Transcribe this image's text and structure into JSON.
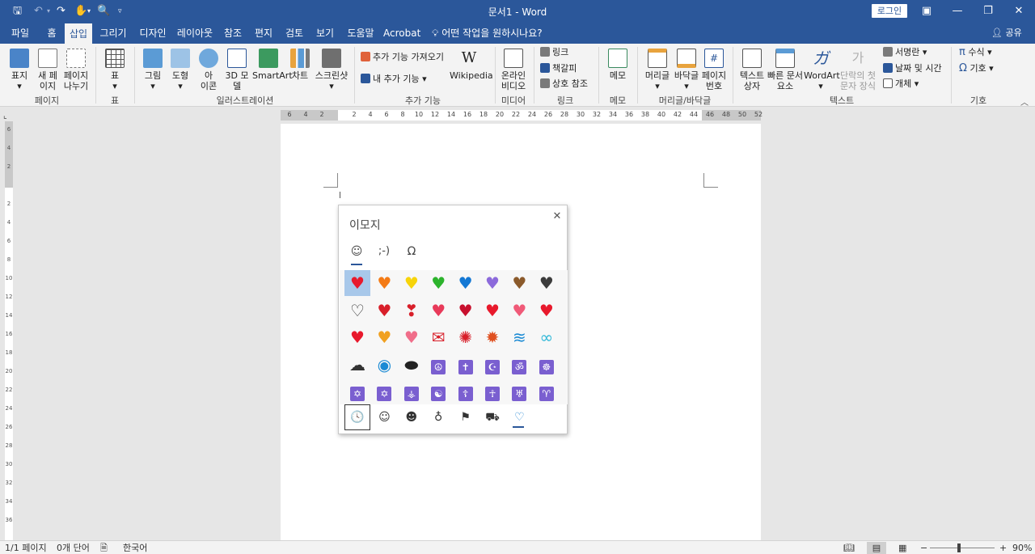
{
  "titlebar": {
    "title": "문서1  -  Word",
    "login": "로그인"
  },
  "tabs": [
    {
      "label": "파일",
      "active": false
    },
    {
      "label": "홈",
      "active": false
    },
    {
      "label": "삽입",
      "active": true
    },
    {
      "label": "그리기",
      "active": false
    },
    {
      "label": "디자인",
      "active": false
    },
    {
      "label": "레이아웃",
      "active": false
    },
    {
      "label": "참조",
      "active": false
    },
    {
      "label": "편지",
      "active": false
    },
    {
      "label": "검토",
      "active": false
    },
    {
      "label": "보기",
      "active": false
    },
    {
      "label": "도움말",
      "active": false
    },
    {
      "label": "Acrobat",
      "active": false
    }
  ],
  "tellme": "어떤 작업을 원하시나요?",
  "share": "공유",
  "ribbon": {
    "pages": {
      "cover": "표지",
      "blank": "새 페\n이지",
      "break": "페이지\n나누기",
      "group": "페이지"
    },
    "table": {
      "table": "표",
      "group": "표"
    },
    "illus": {
      "picture": "그림",
      "shape": "도형",
      "icon": "아\n이콘",
      "model3d": "3D 모\n델",
      "smartart": "SmartArt",
      "chart": "차트",
      "screenshot": "스크린샷",
      "group": "일러스트레이션"
    },
    "addins": {
      "get": "추가 기능 가져오기",
      "my": "내 추가 기능",
      "wikipedia": "Wikipedia",
      "group": "추가 기능"
    },
    "media": {
      "video": "온라인\n비디오",
      "group": "미디어"
    },
    "links": {
      "link": "링크",
      "bookmark": "책갈피",
      "xref": "상호 참조",
      "group": "링크"
    },
    "comments": {
      "comment": "메모",
      "group": "메모"
    },
    "hf": {
      "header": "머리글",
      "footer": "바닥글",
      "pagenum": "페이지\n번호",
      "group": "머리글/바닥글"
    },
    "text": {
      "textbox": "텍스트\n상자",
      "quickparts": "빠른 문서\n요소",
      "wordart": "WordArt",
      "dropcap": "단락의 첫\n문자 장식",
      "signature": "서명란",
      "datetime": "날짜 및 시간",
      "object": "개체",
      "group": "텍스트"
    },
    "symbols": {
      "equation": "수식",
      "symbol": "기호",
      "group": "기호"
    }
  },
  "ruler": {
    "h": [
      "6",
      "4",
      "2",
      "",
      "2",
      "4",
      "6",
      "8",
      "10",
      "12",
      "14",
      "16",
      "18",
      "20",
      "22",
      "24",
      "26",
      "28",
      "30",
      "32",
      "34",
      "36",
      "38",
      "40",
      "42",
      "44",
      "46",
      "48",
      "50",
      "52"
    ],
    "v": [
      "6",
      "4",
      "2",
      "",
      "2",
      "4",
      "6",
      "8",
      "10",
      "12",
      "14",
      "16",
      "18",
      "20",
      "22",
      "24",
      "26",
      "28",
      "30",
      "32",
      "34",
      "36"
    ]
  },
  "emoji_panel": {
    "title": "이모지",
    "tabs": [
      {
        "glyph": "☺"
      },
      {
        "glyph": ";-)"
      },
      {
        "glyph": "Ω"
      }
    ],
    "rows": [
      [
        {
          "g": "♥",
          "c": "#e8192c"
        },
        {
          "g": "♥",
          "c": "#f47b16"
        },
        {
          "g": "♥",
          "c": "#f7d40a"
        },
        {
          "g": "♥",
          "c": "#2cb32c"
        },
        {
          "g": "♥",
          "c": "#1478d4"
        },
        {
          "g": "♥",
          "c": "#8c6adb"
        },
        {
          "g": "♥",
          "c": "#8b5a2b"
        },
        {
          "g": "♥",
          "c": "#3c3c3c"
        }
      ],
      [
        {
          "g": "♡",
          "c": "#333333"
        },
        {
          "g": "♥",
          "c": "#d81f2a"
        },
        {
          "g": "❣",
          "c": "#d81f2a"
        },
        {
          "g": "♥",
          "c": "#e83a5a"
        },
        {
          "g": "♥",
          "c": "#c8102e"
        },
        {
          "g": "♥",
          "c": "#e8192c"
        },
        {
          "g": "♥",
          "c": "#f05a78"
        },
        {
          "g": "♥",
          "c": "#e8192c"
        }
      ],
      [
        {
          "g": "♥",
          "c": "#e8192c"
        },
        {
          "g": "♥",
          "c": "#f0a020"
        },
        {
          "g": "♥",
          "c": "#f06e8a"
        },
        {
          "g": "✉",
          "c": "#d81f2a"
        },
        {
          "g": "✺",
          "c": "#d81f2a"
        },
        {
          "g": "✹",
          "c": "#e05020"
        },
        {
          "g": "≋",
          "c": "#1a8ad4"
        },
        {
          "g": "∞",
          "c": "#30b8d8"
        }
      ],
      [
        {
          "g": "☁",
          "c": "#333333"
        },
        {
          "g": "◉",
          "c": "#1a8ad4"
        },
        {
          "g": "⬬",
          "c": "#222222"
        },
        {
          "g": "☮",
          "c": "purple"
        },
        {
          "g": "✝",
          "c": "purple"
        },
        {
          "g": "☪",
          "c": "purple"
        },
        {
          "g": "ॐ",
          "c": "purple"
        },
        {
          "g": "☸",
          "c": "purple"
        }
      ],
      [
        {
          "g": "✡",
          "c": "purple"
        },
        {
          "g": "✡",
          "c": "purple"
        },
        {
          "g": "⚶",
          "c": "purple"
        },
        {
          "g": "☯",
          "c": "purple"
        },
        {
          "g": "☦",
          "c": "purple"
        },
        {
          "g": "☥",
          "c": "purple"
        },
        {
          "g": "♅",
          "c": "purple"
        },
        {
          "g": "♈",
          "c": "purple"
        }
      ]
    ],
    "selected_index": 0,
    "categories": [
      {
        "g": "🕓"
      },
      {
        "g": "☺"
      },
      {
        "g": "☻"
      },
      {
        "g": "♁"
      },
      {
        "g": "⚑"
      },
      {
        "g": "⛟"
      },
      {
        "g": "♡"
      }
    ]
  },
  "status": {
    "page": "1/1 페이지",
    "words": "0개 단어",
    "lang": "한국어",
    "zoom": "90%"
  }
}
